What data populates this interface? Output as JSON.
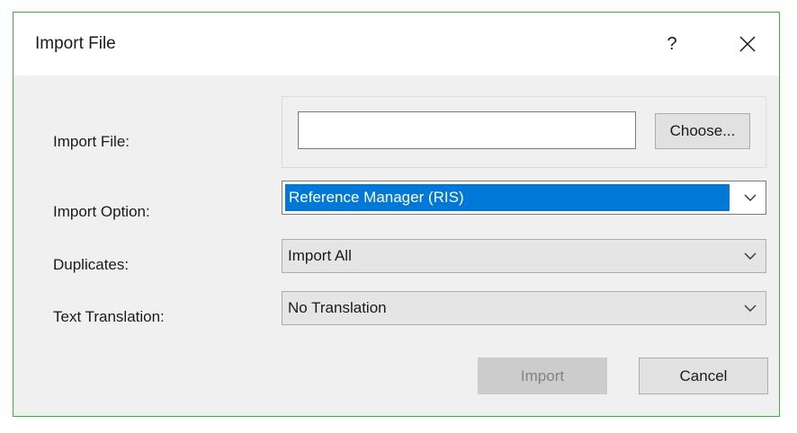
{
  "window": {
    "title": "Import File",
    "help_label": "?",
    "close_label": "×"
  },
  "form": {
    "import_file": {
      "label": "Import File:",
      "value": "",
      "choose_label": "Choose..."
    },
    "import_option": {
      "label": "Import Option:",
      "selected": "Reference Manager (RIS)"
    },
    "duplicates": {
      "label": "Duplicates:",
      "selected": "Import All"
    },
    "text_translation": {
      "label": "Text Translation:",
      "selected": "No Translation"
    }
  },
  "buttons": {
    "import_label": "Import",
    "cancel_label": "Cancel"
  },
  "colors": {
    "accent": "#0078d7",
    "window_border": "#3cb043",
    "dialog_background": "#f0f0f0"
  },
  "icons": {
    "dropdown": "chevron-down-icon",
    "close": "close-icon"
  }
}
